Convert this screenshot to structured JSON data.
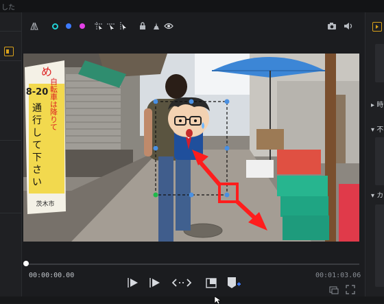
{
  "window": {
    "title_fragment": "した"
  },
  "toolbar": {
    "icons": [
      "align-icon",
      "color-cyan-icon",
      "color-blue-icon",
      "color-magenta-icon",
      "select-region-icon",
      "select-arrow-icon",
      "select-cursor-icon",
      "lock-icon",
      "brush-icon",
      "eye-icon"
    ],
    "colors": {
      "cyan": "#22d3d8",
      "blue": "#3d7bff",
      "magenta": "#e340e6"
    },
    "right_icons": [
      "camera-icon",
      "volume-icon"
    ]
  },
  "right_panel": {
    "items": [
      {
        "arrow": "▸",
        "label": "時"
      },
      {
        "arrow": "▾",
        "label": "不"
      },
      {
        "arrow": "▾",
        "label": "カ"
      }
    ]
  },
  "preview": {
    "sign_left_top": "め",
    "sign_left_lines": [
      "8-20",
      "通",
      "行",
      "し",
      "て",
      "下",
      "さ",
      "い"
    ],
    "sign_red_text": "自転車は降りて",
    "sign_small": "茨木市",
    "accent_red": "#ff1d1d",
    "handle_blue": "#4a90e2",
    "handle_green": "#1fb84a"
  },
  "player": {
    "time_current": "00:00:00.00",
    "time_total": "00:01:03.06",
    "playback_progress": 0
  }
}
